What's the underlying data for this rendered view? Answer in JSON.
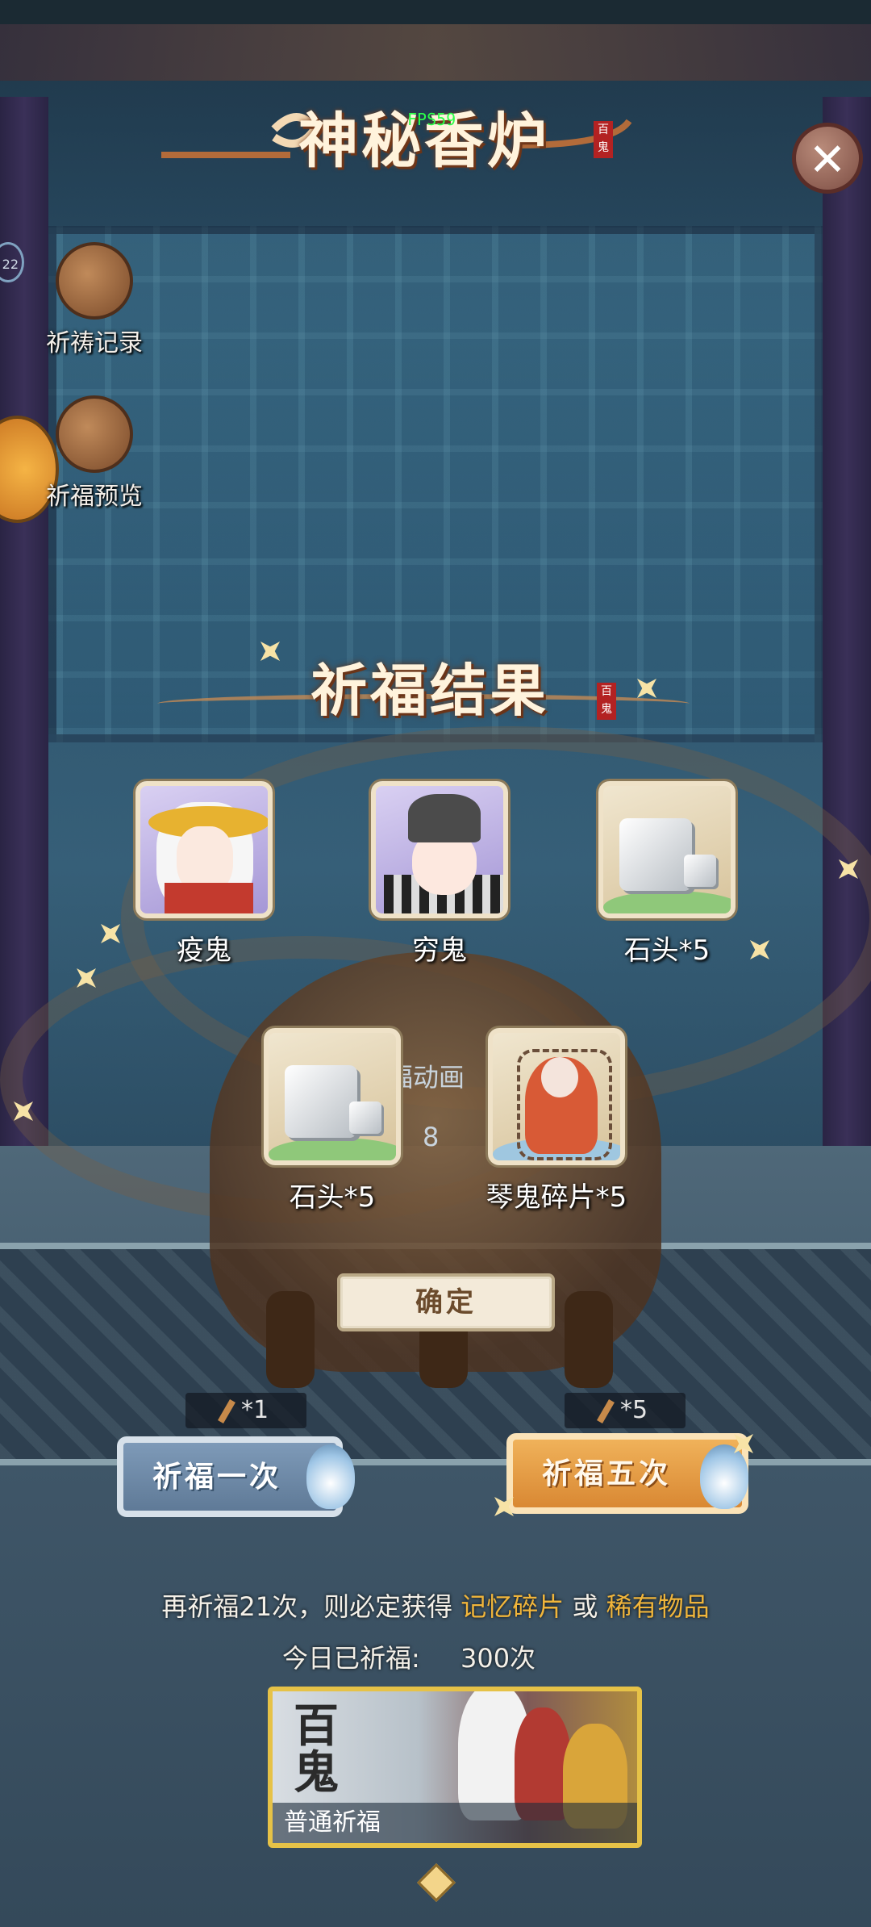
{
  "header": {
    "title": "神秘香炉",
    "seal_text": "百鬼",
    "fps_text": "FPS59",
    "badge_count": "22",
    "close_icon": "close-icon"
  },
  "side_menu": [
    {
      "label": "祈祷记录",
      "icon": "scroll-icon"
    },
    {
      "label": "祈福预览",
      "icon": "incense-bundle-icon"
    }
  ],
  "result": {
    "title": "祈福结果",
    "seal_text": "百鬼",
    "burner_caption": "福动画",
    "burner_count": "8",
    "items_row1": [
      {
        "name": "疫鬼",
        "frame": "purple",
        "art": "plague-ghost"
      },
      {
        "name": "穷鬼",
        "frame": "purple",
        "art": "poor-ghost"
      },
      {
        "name": "石头*5",
        "frame": "tan",
        "art": "stone"
      }
    ],
    "items_row2": [
      {
        "name": "石头*5",
        "frame": "tan",
        "art": "stone"
      },
      {
        "name": "琴鬼碎片*5",
        "frame": "tan",
        "art": "qin-ghost-shard"
      }
    ],
    "confirm_label": "确定"
  },
  "actions": {
    "once": {
      "cost": "*1",
      "label": "祈福一次"
    },
    "five": {
      "cost": "*5",
      "label": "祈福五次"
    }
  },
  "hint": {
    "prefix": "再祈福21次，则必定获得",
    "item1": "记忆碎片",
    "mid": "或",
    "item2": "稀有物品"
  },
  "today": {
    "label": "今日已祈福:",
    "count_suffix": "300次"
  },
  "banner": {
    "logo": "百鬼",
    "label": "普通祈福"
  },
  "colors": {
    "accent_gold": "#f0b53b",
    "pray_once_blue": "#6f8aa8",
    "pray_five_orange": "#e39a45",
    "banner_border": "#e6c247"
  }
}
